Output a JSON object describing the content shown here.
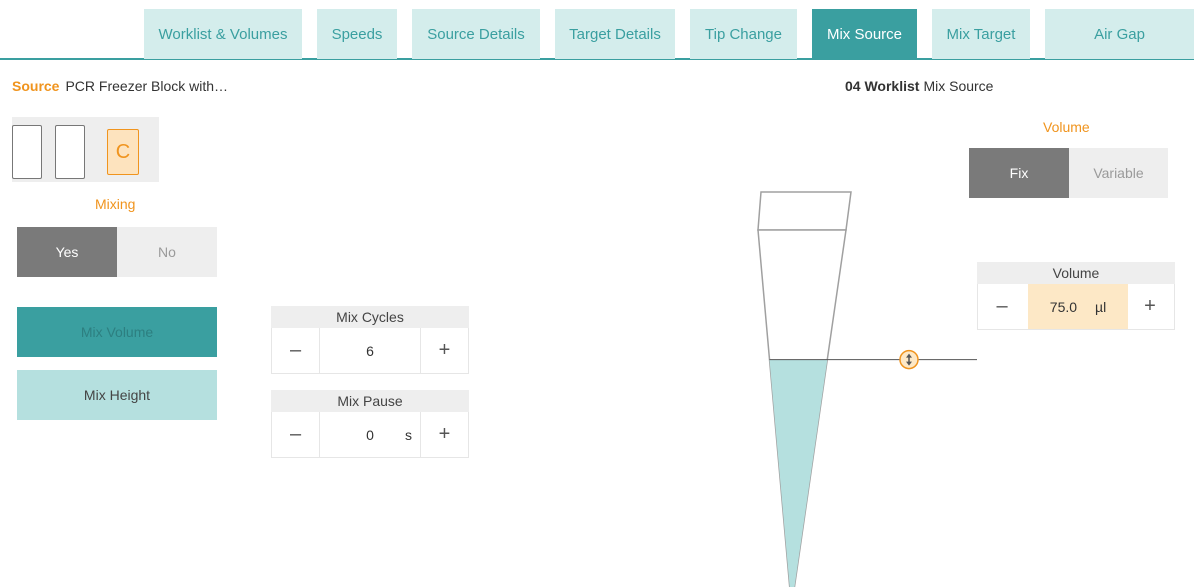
{
  "tabs": [
    {
      "label": "Worklist & Volumes",
      "active": false
    },
    {
      "label": "Speeds",
      "active": false
    },
    {
      "label": "Source Details",
      "active": false
    },
    {
      "label": "Target Details",
      "active": false
    },
    {
      "label": "Tip Change",
      "active": false
    },
    {
      "label": "Mix Source",
      "active": true
    },
    {
      "label": "Mix Target",
      "active": false
    },
    {
      "label": "Air Gap",
      "active": false
    }
  ],
  "source": {
    "key": "Source",
    "value": "PCR Freezer Block with…"
  },
  "worklist": {
    "key": "04 Worklist",
    "value": "Mix Source"
  },
  "plate": {
    "selected_well_label": "C"
  },
  "mixing": {
    "label": "Mixing",
    "yes": "Yes",
    "no": "No",
    "selected": "Yes"
  },
  "modes": {
    "mix_volume": "Mix Volume",
    "mix_height": "Mix Height",
    "selected": "Mix Volume"
  },
  "mix_cycles": {
    "label": "Mix Cycles",
    "value": "6",
    "minus": "–",
    "plus": "+"
  },
  "mix_pause": {
    "label": "Mix Pause",
    "value": "0",
    "unit": "s",
    "minus": "–",
    "plus": "+"
  },
  "volume_mode": {
    "label": "Volume",
    "fix": "Fix",
    "variable": "Variable",
    "selected": "Fix"
  },
  "volume": {
    "label": "Volume",
    "value": "75.0",
    "unit": "µl",
    "minus": "–",
    "plus": "+"
  },
  "tip": {
    "fill_fraction": 0.64,
    "handle_icon": "up-down-arrow-icon"
  },
  "colors": {
    "accent": "#3a9fa0",
    "accent_light": "#d4edec",
    "orange": "#f0941e",
    "liquid": "#b5e0df",
    "selected_gray": "#7a7a7a"
  }
}
